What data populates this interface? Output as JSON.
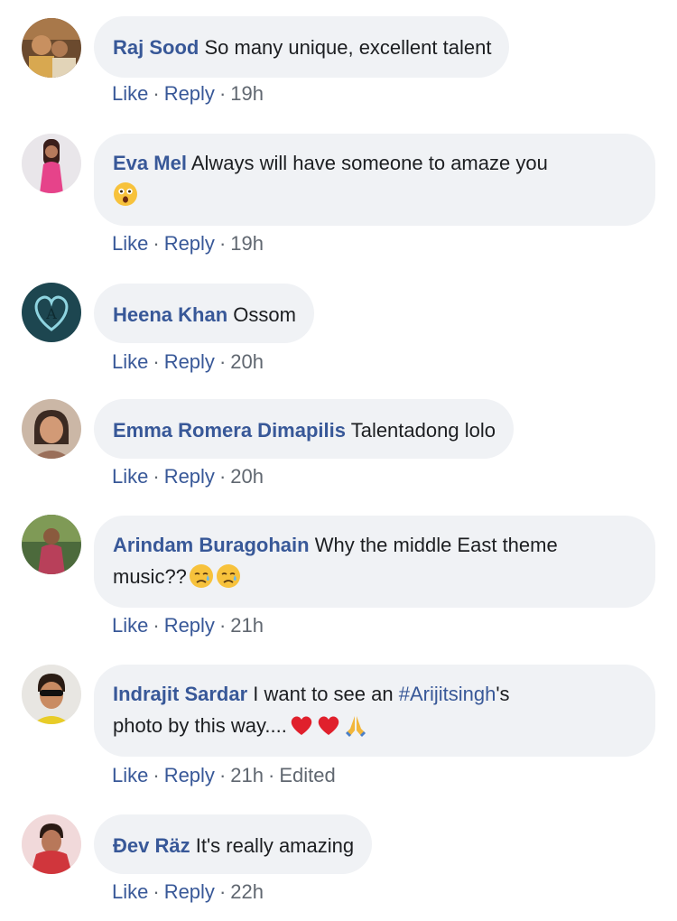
{
  "comments": [
    {
      "author": "Raj Sood",
      "text": "So many unique, excellent talent",
      "like": "Like",
      "reply": "Reply",
      "time": "19h"
    },
    {
      "author": "Eva Mel",
      "text": "Always will have someone to amaze you",
      "emoji": [
        "astonished-face-emoji"
      ],
      "like": "Like",
      "reply": "Reply",
      "time": "19h"
    },
    {
      "author": "Heena Khan",
      "text": "Ossom",
      "like": "Like",
      "reply": "Reply",
      "time": "20h"
    },
    {
      "author": "Emma Romera Dimapilis",
      "text": "Talentadong lolo",
      "like": "Like",
      "reply": "Reply",
      "time": "20h"
    },
    {
      "author": "Arindam Buragohain",
      "text_line1": "Why the middle East theme",
      "text_line2": "music??",
      "emoji": [
        "sad-relieved-face-emoji",
        "sad-relieved-face-emoji"
      ],
      "like": "Like",
      "reply": "Reply",
      "time": "21h"
    },
    {
      "author": "Indrajit Sardar",
      "text_before": "I want to see an",
      "hashtag": "#Arijitsingh",
      "text_after": "'s",
      "text_line2": "photo by this way....",
      "emoji": [
        "red-heart-emoji",
        "red-heart-emoji",
        "folded-hands-emoji"
      ],
      "like": "Like",
      "reply": "Reply",
      "time": "21h",
      "edited": "Edited"
    },
    {
      "author": "Ðev Räz",
      "text": "It's really amazing",
      "like": "Like",
      "reply": "Reply",
      "time": "22h"
    }
  ],
  "colors": {
    "author_link": "#385898",
    "bubble_bg": "#f0f2f5",
    "meta_text": "#606770",
    "body_text": "#1c1e21"
  }
}
